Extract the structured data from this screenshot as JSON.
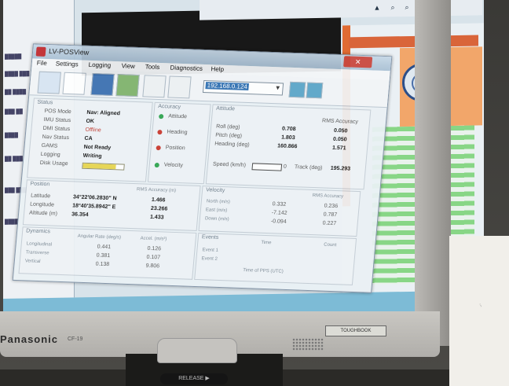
{
  "window": {
    "title": "LV-POSView",
    "close_glyph": "✕",
    "menu": [
      "File",
      "Settings",
      "Logging",
      "View",
      "Tools",
      "Diagnostics",
      "Help"
    ],
    "ip_address": "192.168.0.124",
    "ip_arrow": "▼"
  },
  "status": {
    "title": "Status",
    "rows": [
      {
        "label": "POS Mode",
        "value": "Nav: Aligned",
        "style": "normal"
      },
      {
        "label": "IMU Status",
        "value": "OK",
        "style": "normal"
      },
      {
        "label": "DMI Status",
        "value": "Offline",
        "style": "red"
      },
      {
        "label": "Nav Status",
        "value": "CA",
        "style": "normal"
      },
      {
        "label": "GAMS",
        "value": "Not Ready",
        "style": "normal"
      },
      {
        "label": "Logging",
        "value": "Writing",
        "style": "normal"
      },
      {
        "label": "Disk Usage",
        "value": "",
        "style": "normal"
      }
    ],
    "disk_usage_fraction": 0.8
  },
  "accuracy": {
    "title": "Accuracy",
    "items": [
      {
        "label": "Attitude",
        "color": "#2da44e"
      },
      {
        "label": "Heading",
        "color": "#c9372c"
      },
      {
        "label": "Position",
        "color": "#c9372c"
      },
      {
        "label": "Velocity",
        "color": "#2da44e"
      }
    ]
  },
  "attitude": {
    "title": "Attitude",
    "rms_header": "RMS Accuracy",
    "rows": [
      {
        "label": "Roll (deg)",
        "value": "0.708",
        "rms": "0.050"
      },
      {
        "label": "Pitch (deg)",
        "value": "1.803",
        "rms": "0.050"
      },
      {
        "label": "Heading (deg)",
        "value": "160.866",
        "rms": "1.571"
      }
    ],
    "speed_label": "Speed (km/h)",
    "speed_value": "0",
    "track_label": "Track (deg)",
    "track_value": "195.293"
  },
  "position": {
    "title": "Position",
    "rms_header": "RMS Accuracy (m)",
    "rows": [
      {
        "label": "Latitude",
        "value": "34°22'06.2830\" N",
        "rms": "1.466"
      },
      {
        "label": "Longitude",
        "value": "18°40'35.8942\" E",
        "rms": "23.266"
      },
      {
        "label": "Altitude (m)",
        "value": "36.354",
        "rms": "1.433"
      }
    ]
  },
  "dynamics": {
    "title": "Dynamics",
    "header": "Angular Rate (deg/s)",
    "header2": "Accel. (m/s²)",
    "rows": [
      {
        "label": "Longitudinal",
        "value": "0.441",
        "value2": "0.126"
      },
      {
        "label": "Transverse",
        "value": "0.381",
        "value2": "0.107"
      },
      {
        "label": "Vertical",
        "value": "0.138",
        "value2": "9.806"
      }
    ]
  },
  "velocity": {
    "title": "Velocity",
    "rms_header": "RMS Accuracy",
    "rows": [
      {
        "label": "North (m/s)",
        "value": "0.332",
        "rms": "0.236"
      },
      {
        "label": "East (m/s)",
        "value": "-7.142",
        "rms": "0.787"
      },
      {
        "label": "Down (m/s)",
        "value": "-0.094",
        "rms": "0.227"
      }
    ]
  },
  "events": {
    "title": "Events",
    "col1": "Time",
    "col2": "Count",
    "rows": [
      "Event 1",
      "Event 2"
    ],
    "pps": "Time of PPS (UTC)"
  },
  "laptop": {
    "brand": "Panasonic",
    "model": "CF-19",
    "badge": "TOUGHBOOK",
    "release": "RELEASE ▶"
  },
  "paper_text": "..."
}
